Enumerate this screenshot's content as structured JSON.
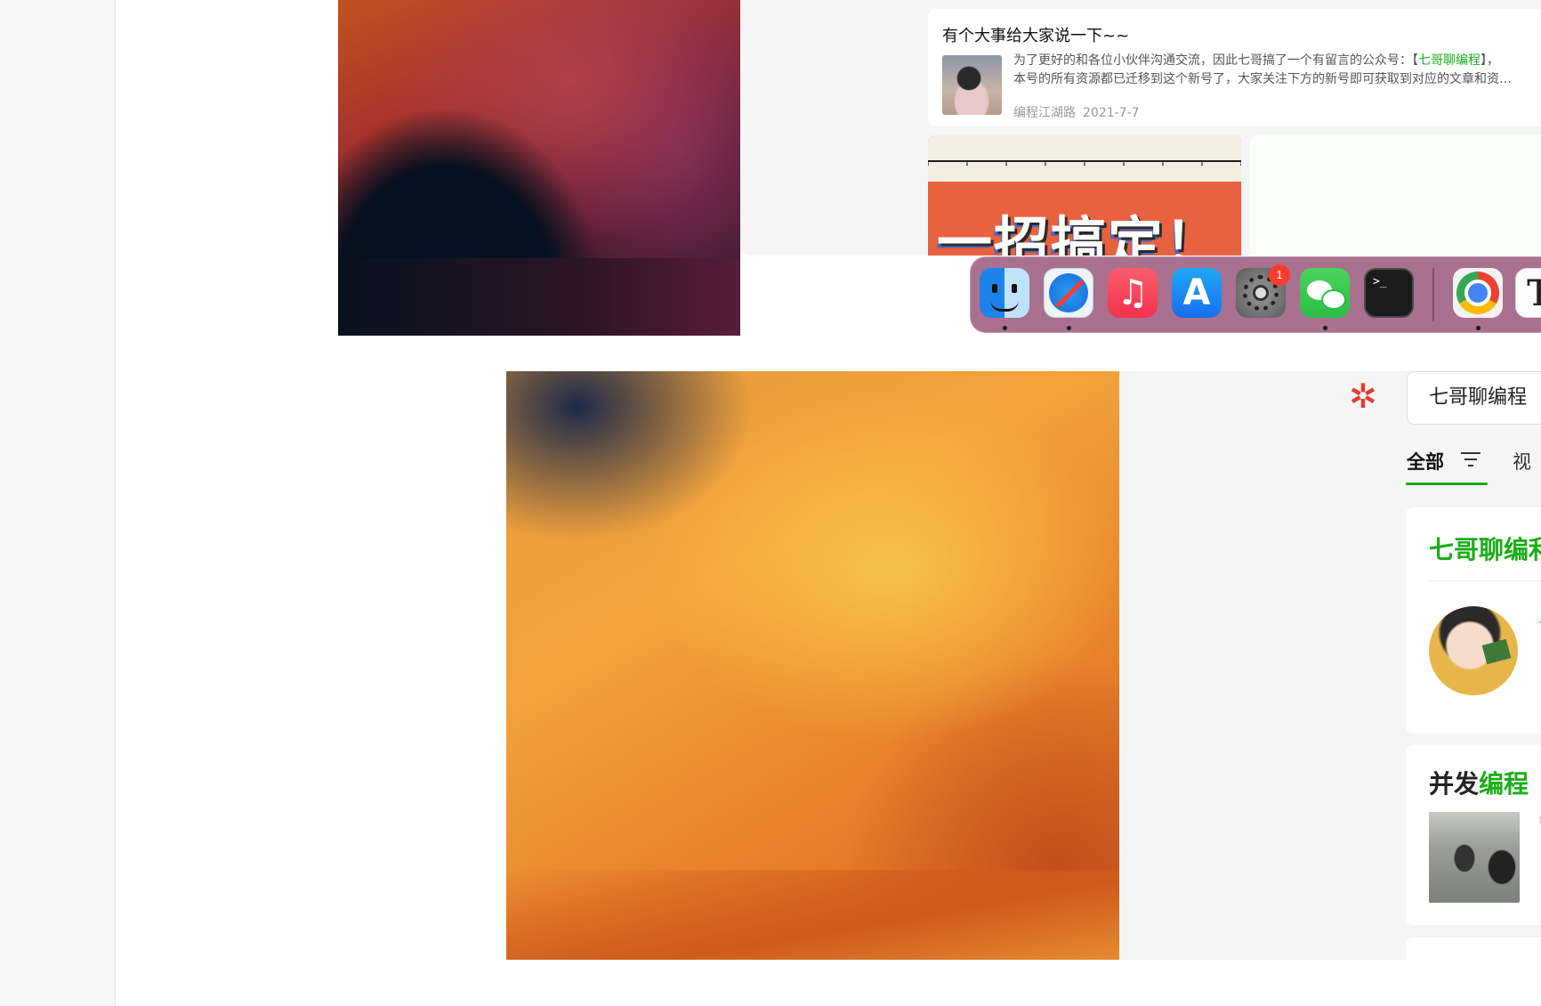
{
  "top_screenshot": {
    "article": {
      "title": "有个大事给大家说一下~~",
      "desc_line1_prefix": "为了更好的和各位小伙伴沟通交流，因此七哥搞了一个有留言的公众号：【",
      "desc_line1_link": "七哥聊编程",
      "desc_line1_suffix": "】，",
      "desc_line2": "本号的所有资源都已迁移到这个新号了，大家关注下方的新号即可获取到对应的文章和资…",
      "author": "编程江湖路",
      "date": "2021-7-7"
    },
    "promo_banner": {
      "text": "一招搞定！"
    },
    "dock": {
      "badge_count": "1",
      "terminal_prompt": ">_",
      "typora_glyph": "T",
      "app_icons": [
        "finder-icon",
        "safari-icon",
        "music-icon",
        "app-store-icon",
        "system-settings-icon",
        "wechat-icon",
        "terminal-icon",
        "chrome-icon",
        "typora-icon",
        "preview-icon",
        "downloads-folder-icon",
        "trash-icon"
      ],
      "running_apps": [
        "finder-icon",
        "safari-icon",
        "wechat-icon",
        "chrome-icon"
      ]
    }
  },
  "bottom_screenshot": {
    "search": {
      "query": "七哥聊编程"
    },
    "tabs": {
      "all": "全部",
      "video": "视"
    },
    "account_card": {
      "title": "七哥聊编利",
      "side_text": "一"
    },
    "article_card": {
      "title_prefix": "并发",
      "title_highlight": "编程",
      "title_suffix": " "
    }
  }
}
